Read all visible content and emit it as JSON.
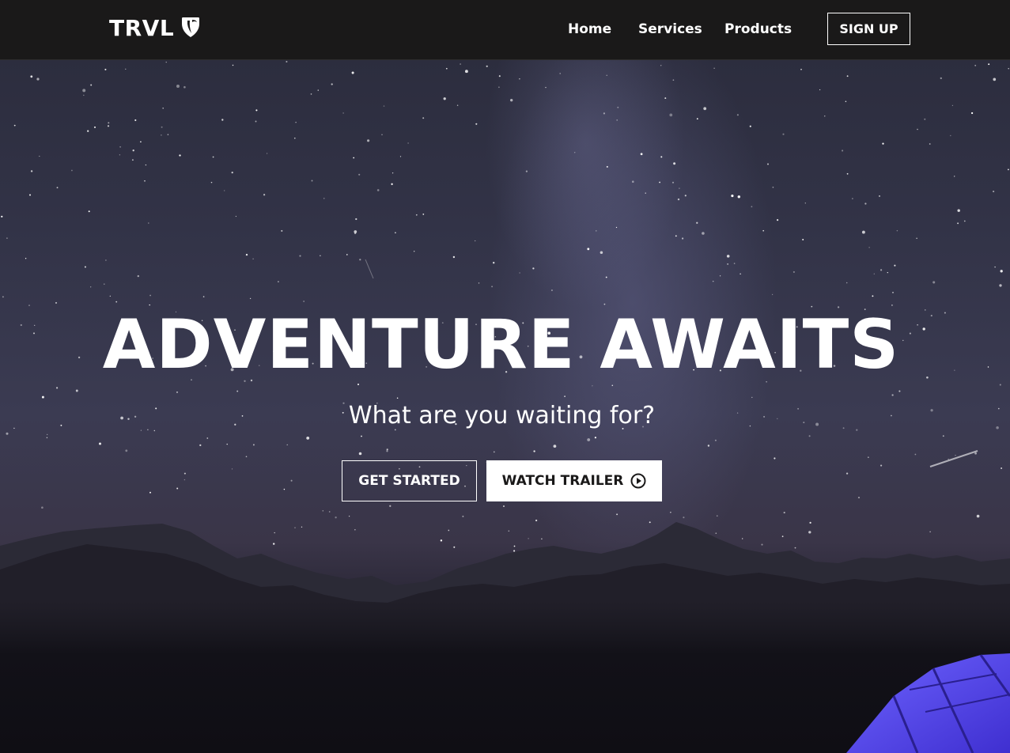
{
  "navbar": {
    "brand": "TRVL",
    "brand_icon": "typo3-shield-icon",
    "links": [
      {
        "label": "Home"
      },
      {
        "label": "Services"
      },
      {
        "label": "Products"
      }
    ],
    "signup_label": "SIGN UP"
  },
  "hero": {
    "title": "ADVENTURE AWAITS",
    "subtitle": "What are you waiting for?",
    "primary_button": "GET STARTED",
    "secondary_button": "WATCH TRAILER",
    "secondary_button_icon": "play-circle-icon",
    "background": "night-sky-mountains-tent-photo"
  },
  "colors": {
    "navbar_bg": "#1a1919",
    "text": "#ffffff",
    "tent": "#5a4ee0"
  }
}
